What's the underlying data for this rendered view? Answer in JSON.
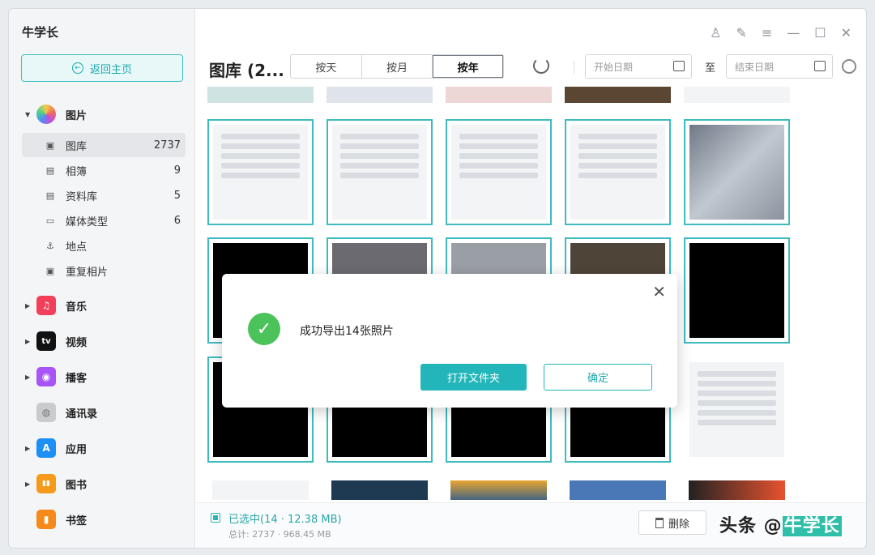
{
  "app": {
    "name": "牛学长"
  },
  "sidebar": {
    "home_button": "返回主页",
    "photos_category": "图片",
    "photo_items": [
      {
        "label": "图库",
        "count": "2737"
      },
      {
        "label": "相簿",
        "count": "9"
      },
      {
        "label": "资料库",
        "count": "5"
      },
      {
        "label": "媒体类型",
        "count": "6"
      },
      {
        "label": "地点",
        "count": ""
      },
      {
        "label": "重复相片",
        "count": ""
      }
    ],
    "categories": [
      {
        "label": "音乐",
        "badge": "♫",
        "color": "#f2405a"
      },
      {
        "label": "视频",
        "badge": "tv",
        "color": "#111111"
      },
      {
        "label": "播客",
        "badge": "◉",
        "color": "#a855f7"
      },
      {
        "label": "通讯录",
        "badge": "◍",
        "color": "#c9cbce"
      },
      {
        "label": "应用",
        "badge": "A",
        "color": "#1d8ff5"
      },
      {
        "label": "图书",
        "badge": "▮▮",
        "color": "#f59a1b"
      },
      {
        "label": "书签",
        "badge": "▮",
        "color": "#f58a1b"
      }
    ]
  },
  "toolbar": {
    "title": "图库 (2...",
    "segments": [
      "按天",
      "按月",
      "按年"
    ],
    "active_segment": "按年",
    "start_date_placeholder": "开始日期",
    "to_label": "至",
    "end_date_placeholder": "结束日期"
  },
  "dialog": {
    "message": "成功导出14张照片",
    "open_folder_button": "打开文件夹",
    "confirm_button": "确定"
  },
  "footer": {
    "selected": "已选中(14 · 12.38 MB)",
    "total": "总计: 2737 · 968.45 MB",
    "delete_button": "删除",
    "watermark_prefix": "头条 @",
    "watermark_name": "牛学长"
  },
  "colors": {
    "accent": "#22b5b9",
    "selection": "#3dbbc1",
    "success": "#4cc25a"
  }
}
